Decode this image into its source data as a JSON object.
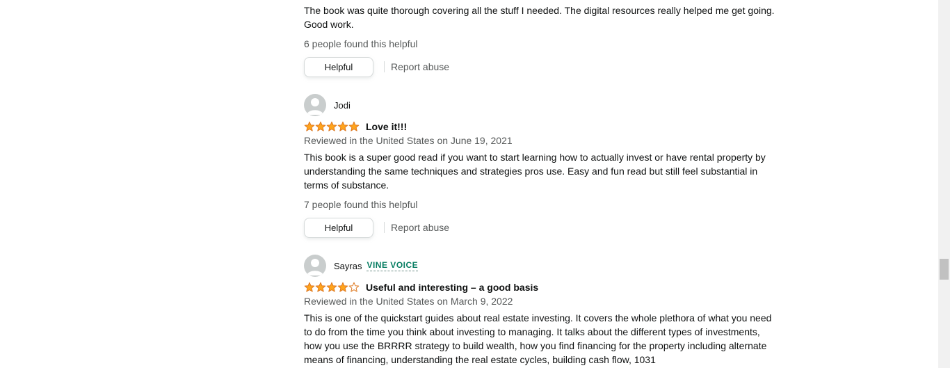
{
  "review_prev": {
    "body": "The book was quite thorough covering all the stuff I needed. The digital resources really helped me get going. Good work.",
    "helpful_count": "6 people found this helpful",
    "helpful_label": "Helpful",
    "report_label": "Report abuse"
  },
  "review_jodi": {
    "author": "Jodi",
    "rating": 5,
    "title": "Love it!!!",
    "meta": "Reviewed in the United States on June 19, 2021",
    "body": "This book is a super good read if you want to start learning how to actually invest or have rental property by understanding the same techniques and strategies pros use. Easy and fun read but still feel substantial in terms of substance.",
    "helpful_count": "7 people found this helpful",
    "helpful_label": "Helpful",
    "report_label": "Report abuse"
  },
  "review_sayras": {
    "author": "Sayras",
    "badge": "VINE VOICE",
    "rating": 4,
    "title": "Useful and interesting – a good basis",
    "meta": "Reviewed in the United States on March 9, 2022",
    "body": "This is one of the quickstart guides about real estate investing. It covers the whole plethora of what you need to do from the time you think about investing to managing. It talks about the different types of investments, how you use the BRRRR strategy to build wealth, how you find financing for the property including alternate means of financing, understanding the real estate cycles, building cash flow, 1031"
  },
  "colors": {
    "star_fill": "#ffa41c",
    "star_stroke": "#de7921",
    "vine_badge": "#067d62",
    "muted_text": "#565959"
  },
  "scrollbar": {
    "position": 0.73
  }
}
